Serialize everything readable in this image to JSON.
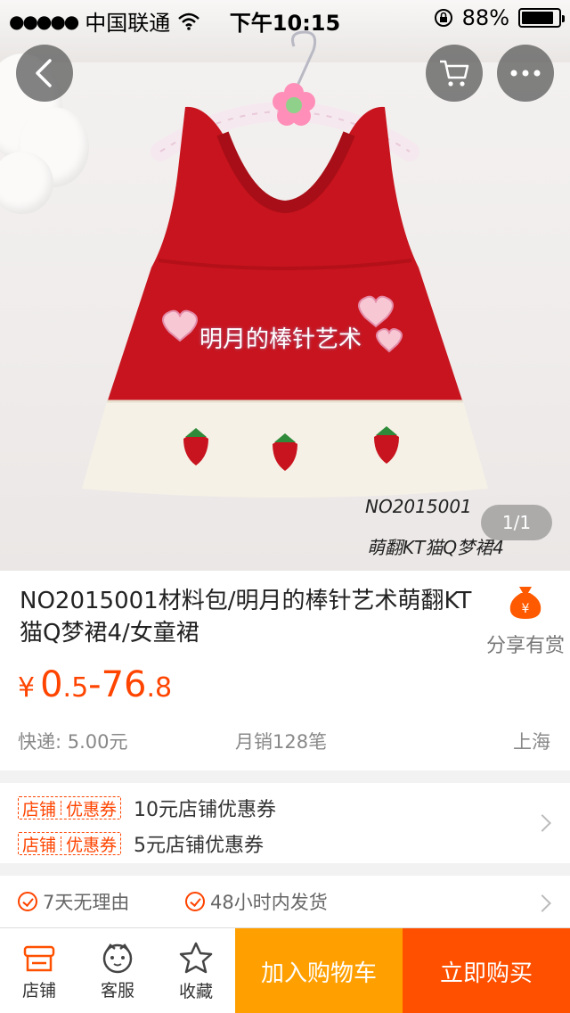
{
  "status_bar": {
    "signal": "●●●●●",
    "carrier": "中国联通",
    "time": "下午10:15",
    "battery_percent": "88%",
    "battery_level": 0.88
  },
  "hero": {
    "watermark": "明月的棒针艺术",
    "photo_caption_code": "NO2015001",
    "photo_caption_name": "萌翻KT猫Q梦裙4",
    "pager": "1/1",
    "colors": {
      "dress_red": "#c8141e",
      "dress_cream": "#f6f1e6"
    }
  },
  "nav": {
    "back_icon": "chevron-left-icon",
    "cart_icon": "cart-icon",
    "more_icon": "more-dots-icon"
  },
  "product": {
    "title": "NO2015001材料包/明月的棒针艺术萌翻KT猫Q梦裙4/女童裙",
    "share_label": "分享有赏",
    "price_currency": "¥",
    "price_min_int": "0",
    "price_min_dec": ".5",
    "price_sep": "-",
    "price_max_int": "76",
    "price_max_dec": ".8",
    "shipping": "快递: 5.00元",
    "monthly_sales": "月销128笔",
    "location": "上海"
  },
  "coupons": {
    "tag_left": "店铺",
    "tag_right": "优惠券",
    "items": [
      "10元店铺优惠券",
      "5元店铺优惠券"
    ]
  },
  "services": [
    "7天无理由",
    "48小时内发货"
  ],
  "bottom_bar": {
    "shop_label": "店铺",
    "service_label": "客服",
    "favorite_label": "收藏",
    "add_to_cart": "加入购物车",
    "buy_now": "立即购买"
  },
  "colors": {
    "accent": "#ff4400",
    "add_cart_bg": "#ffa000",
    "buy_now_bg": "#ff5000"
  }
}
